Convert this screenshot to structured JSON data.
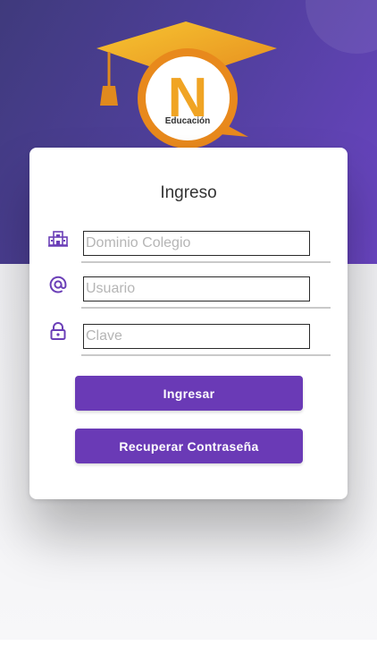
{
  "brand": {
    "logo_letter": "N",
    "logo_text": "Educación",
    "colors": {
      "purple": "#6a3ab6",
      "cap_gold": "#f0b324",
      "cap_orange": "#e08a1e"
    }
  },
  "login": {
    "title": "Ingreso",
    "fields": [
      {
        "icon": "school-icon",
        "placeholder": "Dominio Colegio",
        "value": ""
      },
      {
        "icon": "at-icon",
        "placeholder": "Usuario",
        "value": ""
      },
      {
        "icon": "lock-icon",
        "placeholder": "Clave",
        "value": ""
      }
    ],
    "login_button": "Ingresar",
    "recover_button": "Recuperar Contraseña"
  }
}
